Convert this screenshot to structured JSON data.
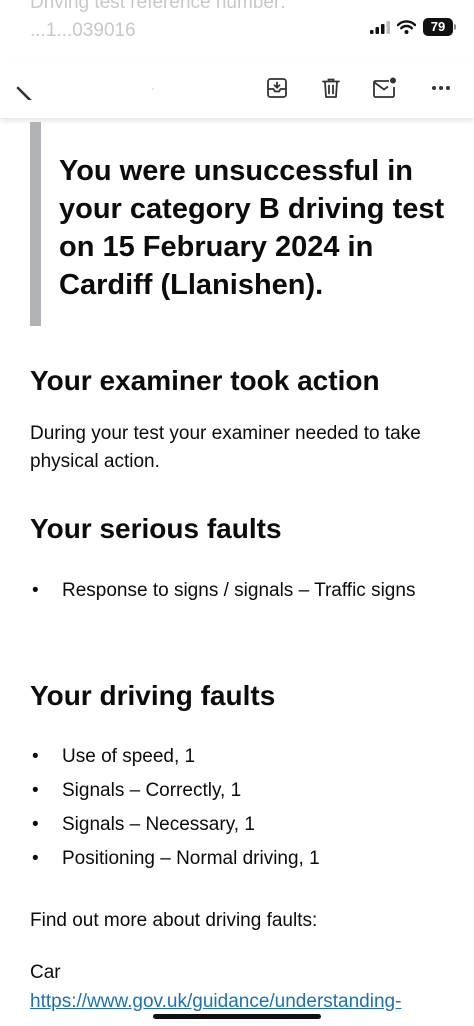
{
  "background_text": {
    "line1": "Driving test reference number:",
    "line2": "...1...039016"
  },
  "status_bar": {
    "battery_level": "79"
  },
  "toolbar": {
    "back_icon": "back-chevron-icon",
    "archive_icon": "archive-icon",
    "delete_icon": "trash-icon",
    "unread_icon": "mail-unread-icon",
    "more_icon": "more-icon"
  },
  "email": {
    "result_callout": "You were unsuccessful in your category B driving test on 15 February 2024 in Cardiff (Llanishen).",
    "examiner_heading": "Your examiner took action",
    "examiner_text": "During your test your examiner needed to take physical action.",
    "serious_heading": "Your serious faults",
    "serious_faults": [
      "Response to signs / signals – Traffic signs"
    ],
    "driving_heading": "Your driving faults",
    "driving_faults": [
      "Use of speed, 1",
      "Signals – Correctly, 1",
      "Signals – Necessary, 1",
      "Positioning – Normal driving, 1"
    ],
    "find_out_more": "Find out more about driving faults:",
    "vehicle_label": "Car",
    "guidance_link": "https://www.gov.uk/guidance/understanding-"
  },
  "colors": {
    "link": "#1d70b8",
    "callout_border": "#b1b4b6",
    "text": "#0b0c0c"
  }
}
